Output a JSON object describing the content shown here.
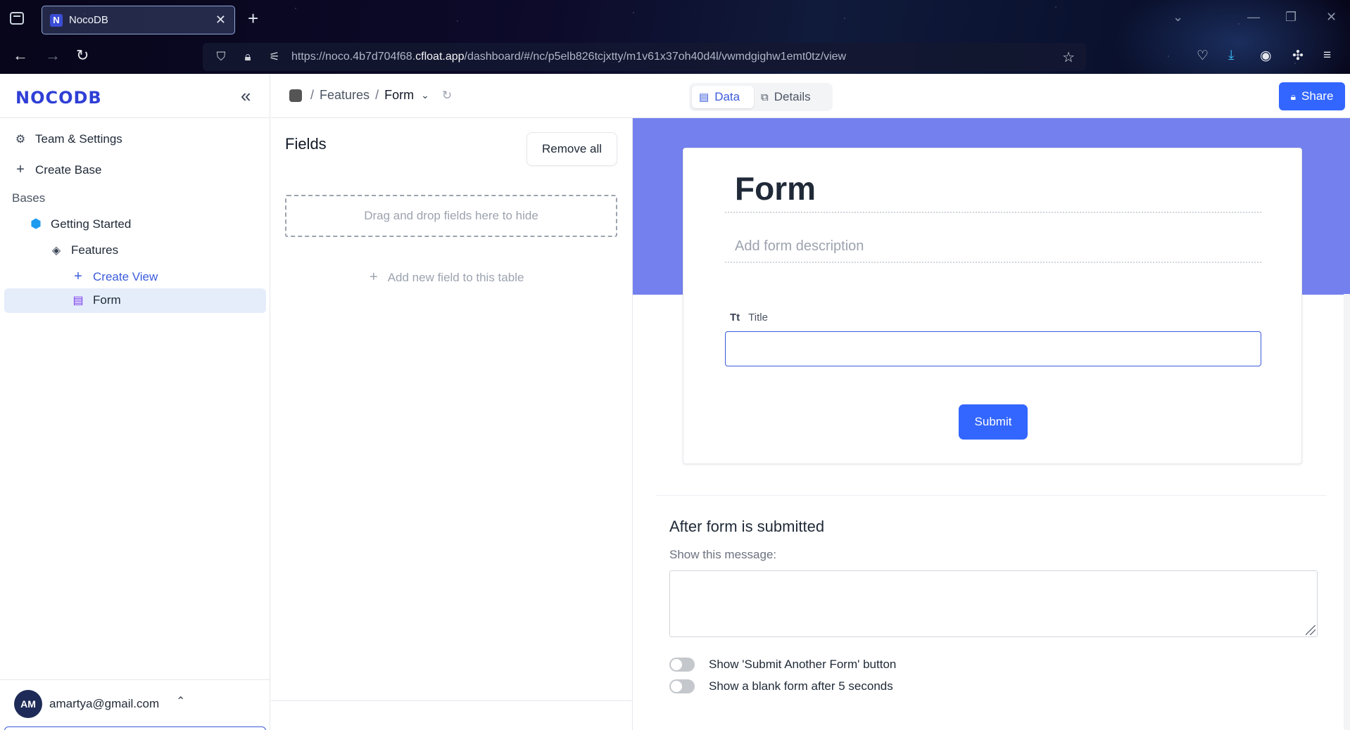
{
  "browser": {
    "tab_title": "NocoDB",
    "tab_favicon_letter": "N",
    "url_prefix": "https://noco.4b7d704f68.",
    "url_domain": "cfloat.app",
    "url_path": "/dashboard/#/nc/p5elb826tcjxtty/m1v61x37oh40d4l/vwmdgighw1emt0tz/view"
  },
  "sidebar": {
    "logo": "NOCODB",
    "items": [
      {
        "label": "Team & Settings",
        "icon": "gear-icon"
      },
      {
        "label": "Create Base",
        "icon": "plus-icon"
      }
    ],
    "bases_heading": "Bases",
    "base": {
      "label": "Getting Started",
      "icon": "cube-icon"
    },
    "table": {
      "label": "Features",
      "icon": "table-eye-icon"
    },
    "create_view": {
      "label": "Create View",
      "icon": "plus-icon"
    },
    "view": {
      "label": "Form",
      "icon": "form-icon"
    },
    "user": {
      "initials": "AM",
      "email": "amartya@gmail.com"
    }
  },
  "header": {
    "breadcrumb": {
      "table": "Features",
      "view": "Form",
      "separator": "/"
    },
    "tabs": [
      {
        "label": "Data",
        "icon": "data-icon",
        "active": true
      },
      {
        "label": "Details",
        "icon": "details-icon",
        "active": false
      }
    ],
    "share_label": "Share"
  },
  "fields_panel": {
    "title": "Fields",
    "remove_all_label": "Remove all",
    "dropzone_text": "Drag and drop fields here to hide",
    "add_field_label": "Add new field to this table"
  },
  "form": {
    "title": "Form",
    "description_placeholder": "Add form description",
    "fields": [
      {
        "label": "Title",
        "type_icon": "Tt",
        "value": ""
      }
    ],
    "submit_label": "Submit",
    "banner_color": "#7380ee",
    "accent_color": "#3366ff"
  },
  "after_submit": {
    "heading": "After form is submitted",
    "message_label": "Show this message:",
    "message_value": "",
    "options": [
      {
        "label": "Show 'Submit Another Form' button",
        "enabled": false
      },
      {
        "label": "Show a blank form after 5 seconds",
        "enabled": false
      }
    ]
  }
}
